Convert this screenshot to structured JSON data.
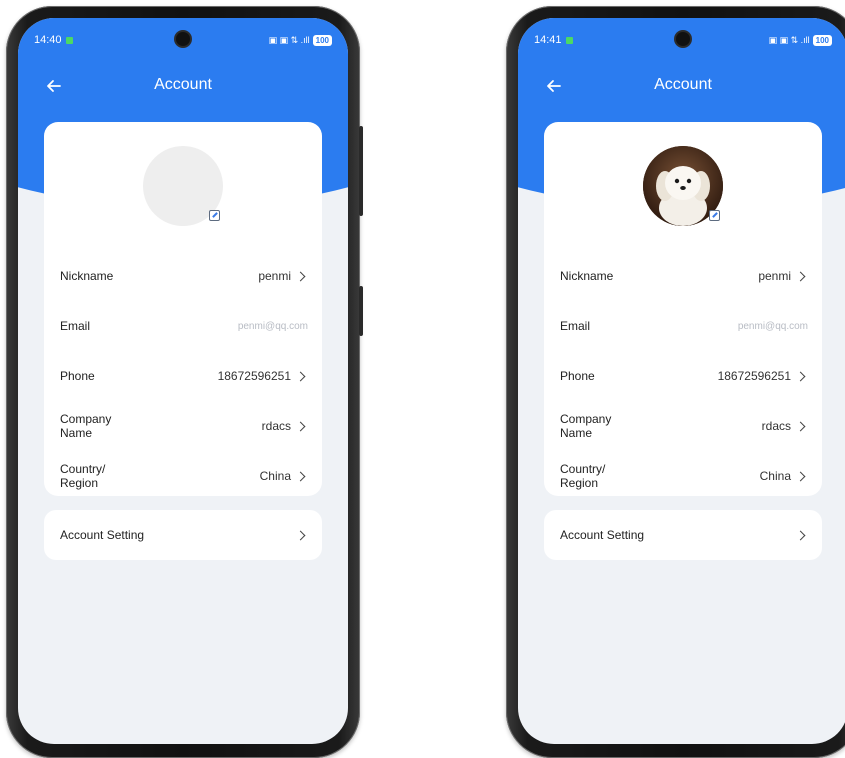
{
  "screens": [
    {
      "status": {
        "time": "14:40",
        "icons": "▣ ▣ ⇅ .ıll",
        "battery": "100"
      },
      "title": "Account",
      "avatar": {
        "state": "placeholder"
      },
      "rows": [
        {
          "label": "Nickname",
          "value": "penmi",
          "chevron": true
        },
        {
          "label": "Email",
          "value": "penmi@qq.com",
          "chevron": false
        },
        {
          "label": "Phone",
          "value": "18672596251",
          "chevron": true
        },
        {
          "label": "Company Name",
          "value": "rdacs",
          "chevron": true
        },
        {
          "label": "Country/ Region",
          "value": "China",
          "chevron": true
        }
      ],
      "setting": {
        "label": "Account Setting"
      }
    },
    {
      "status": {
        "time": "14:41",
        "icons": "▣ ▣ ⇅ .ıll",
        "battery": "100"
      },
      "title": "Account",
      "avatar": {
        "state": "photo",
        "subject": "white-puppy"
      },
      "rows": [
        {
          "label": "Nickname",
          "value": "penmi",
          "chevron": true
        },
        {
          "label": "Email",
          "value": "penmi@qq.com",
          "chevron": false
        },
        {
          "label": "Phone",
          "value": "18672596251",
          "chevron": true
        },
        {
          "label": "Company Name",
          "value": "rdacs",
          "chevron": true
        },
        {
          "label": "Country/ Region",
          "value": "China",
          "chevron": true
        }
      ],
      "setting": {
        "label": "Account Setting"
      }
    }
  ],
  "colors": {
    "accent": "#2b7cf0",
    "background": "#eff2f6",
    "card": "#ffffff"
  }
}
